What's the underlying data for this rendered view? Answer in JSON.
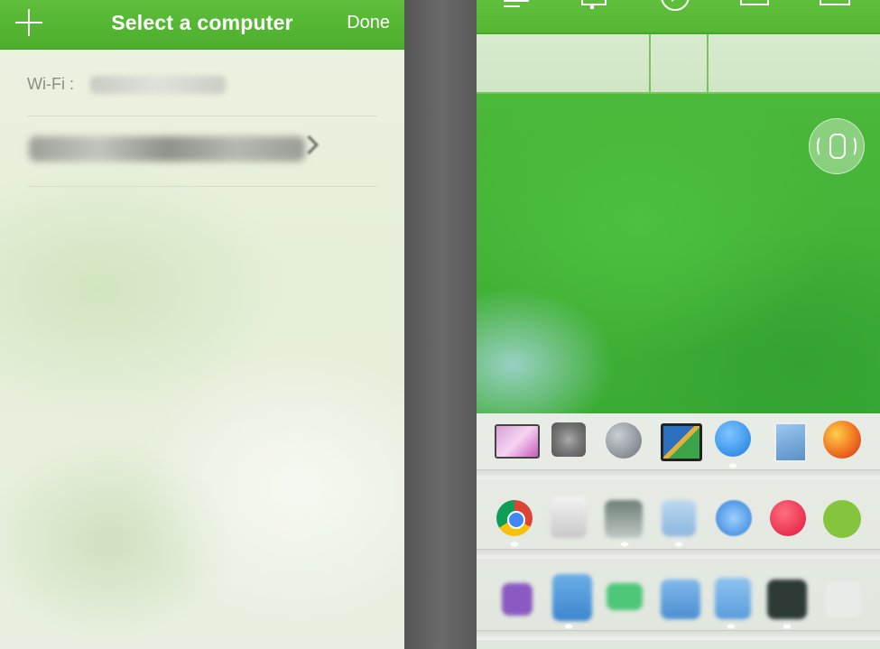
{
  "left_panel": {
    "nav": {
      "add_icon": "plus-icon",
      "title": "Select a computer",
      "done_label": "Done"
    },
    "wifi_label": "Wi-Fi :"
  },
  "right_panel": {
    "toolbar_icons": [
      "menu-icon",
      "monitor-icon",
      "play-icon",
      "window-icon",
      "keyboard-icon"
    ],
    "mouse_mode_icon": "mouse-icon",
    "dock_rows": [
      [
        "launchpad-wallpaper-icon",
        "system-preferences-icon",
        "rocket-launchpad-icon",
        "mission-control-icon",
        "app-store-icon",
        "preview-icon",
        "firefox-icon"
      ],
      [
        "chrome-icon",
        "blurred-app-icon",
        "blurred-app-icon",
        "blurred-app-icon",
        "safari-icon",
        "itunes-icon",
        "spotify-icon"
      ],
      [
        "blurred-app-icon",
        "blurred-app-icon",
        "blurred-app-icon",
        "blurred-app-icon",
        "blurred-app-icon",
        "blurred-app-icon",
        "blurred-app-icon"
      ]
    ]
  },
  "colors": {
    "accent_green": "#4cae2c",
    "done_text": "#ffffff",
    "wifi_label": "#8a8f86"
  }
}
